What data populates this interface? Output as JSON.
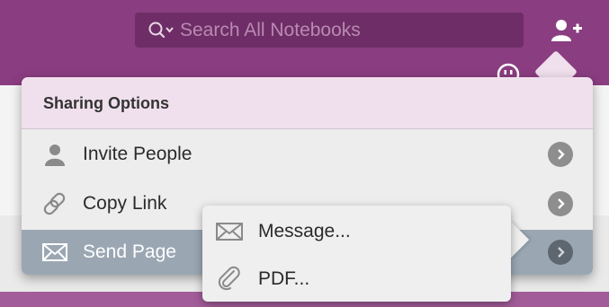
{
  "search": {
    "placeholder": "Search All Notebooks"
  },
  "toolbar": {
    "add_user_icon": "add-user-icon",
    "emoji_icon": "smiley-icon"
  },
  "sharing": {
    "title": "Sharing Options",
    "items": [
      {
        "label": "Invite People",
        "icon": "person-icon"
      },
      {
        "label": "Copy Link",
        "icon": "link-icon"
      },
      {
        "label": "Send Page",
        "icon": "envelope-icon",
        "selected": true
      }
    ]
  },
  "send_submenu": {
    "items": [
      {
        "label": "Message...",
        "icon": "envelope-icon"
      },
      {
        "label": "PDF...",
        "icon": "paperclip-icon"
      }
    ]
  },
  "colors": {
    "titlebar": "#8a3d80",
    "header_tint": "#f0e0ed",
    "selected_row": "#9aa7b3",
    "chevron": "#8e8e8e"
  }
}
